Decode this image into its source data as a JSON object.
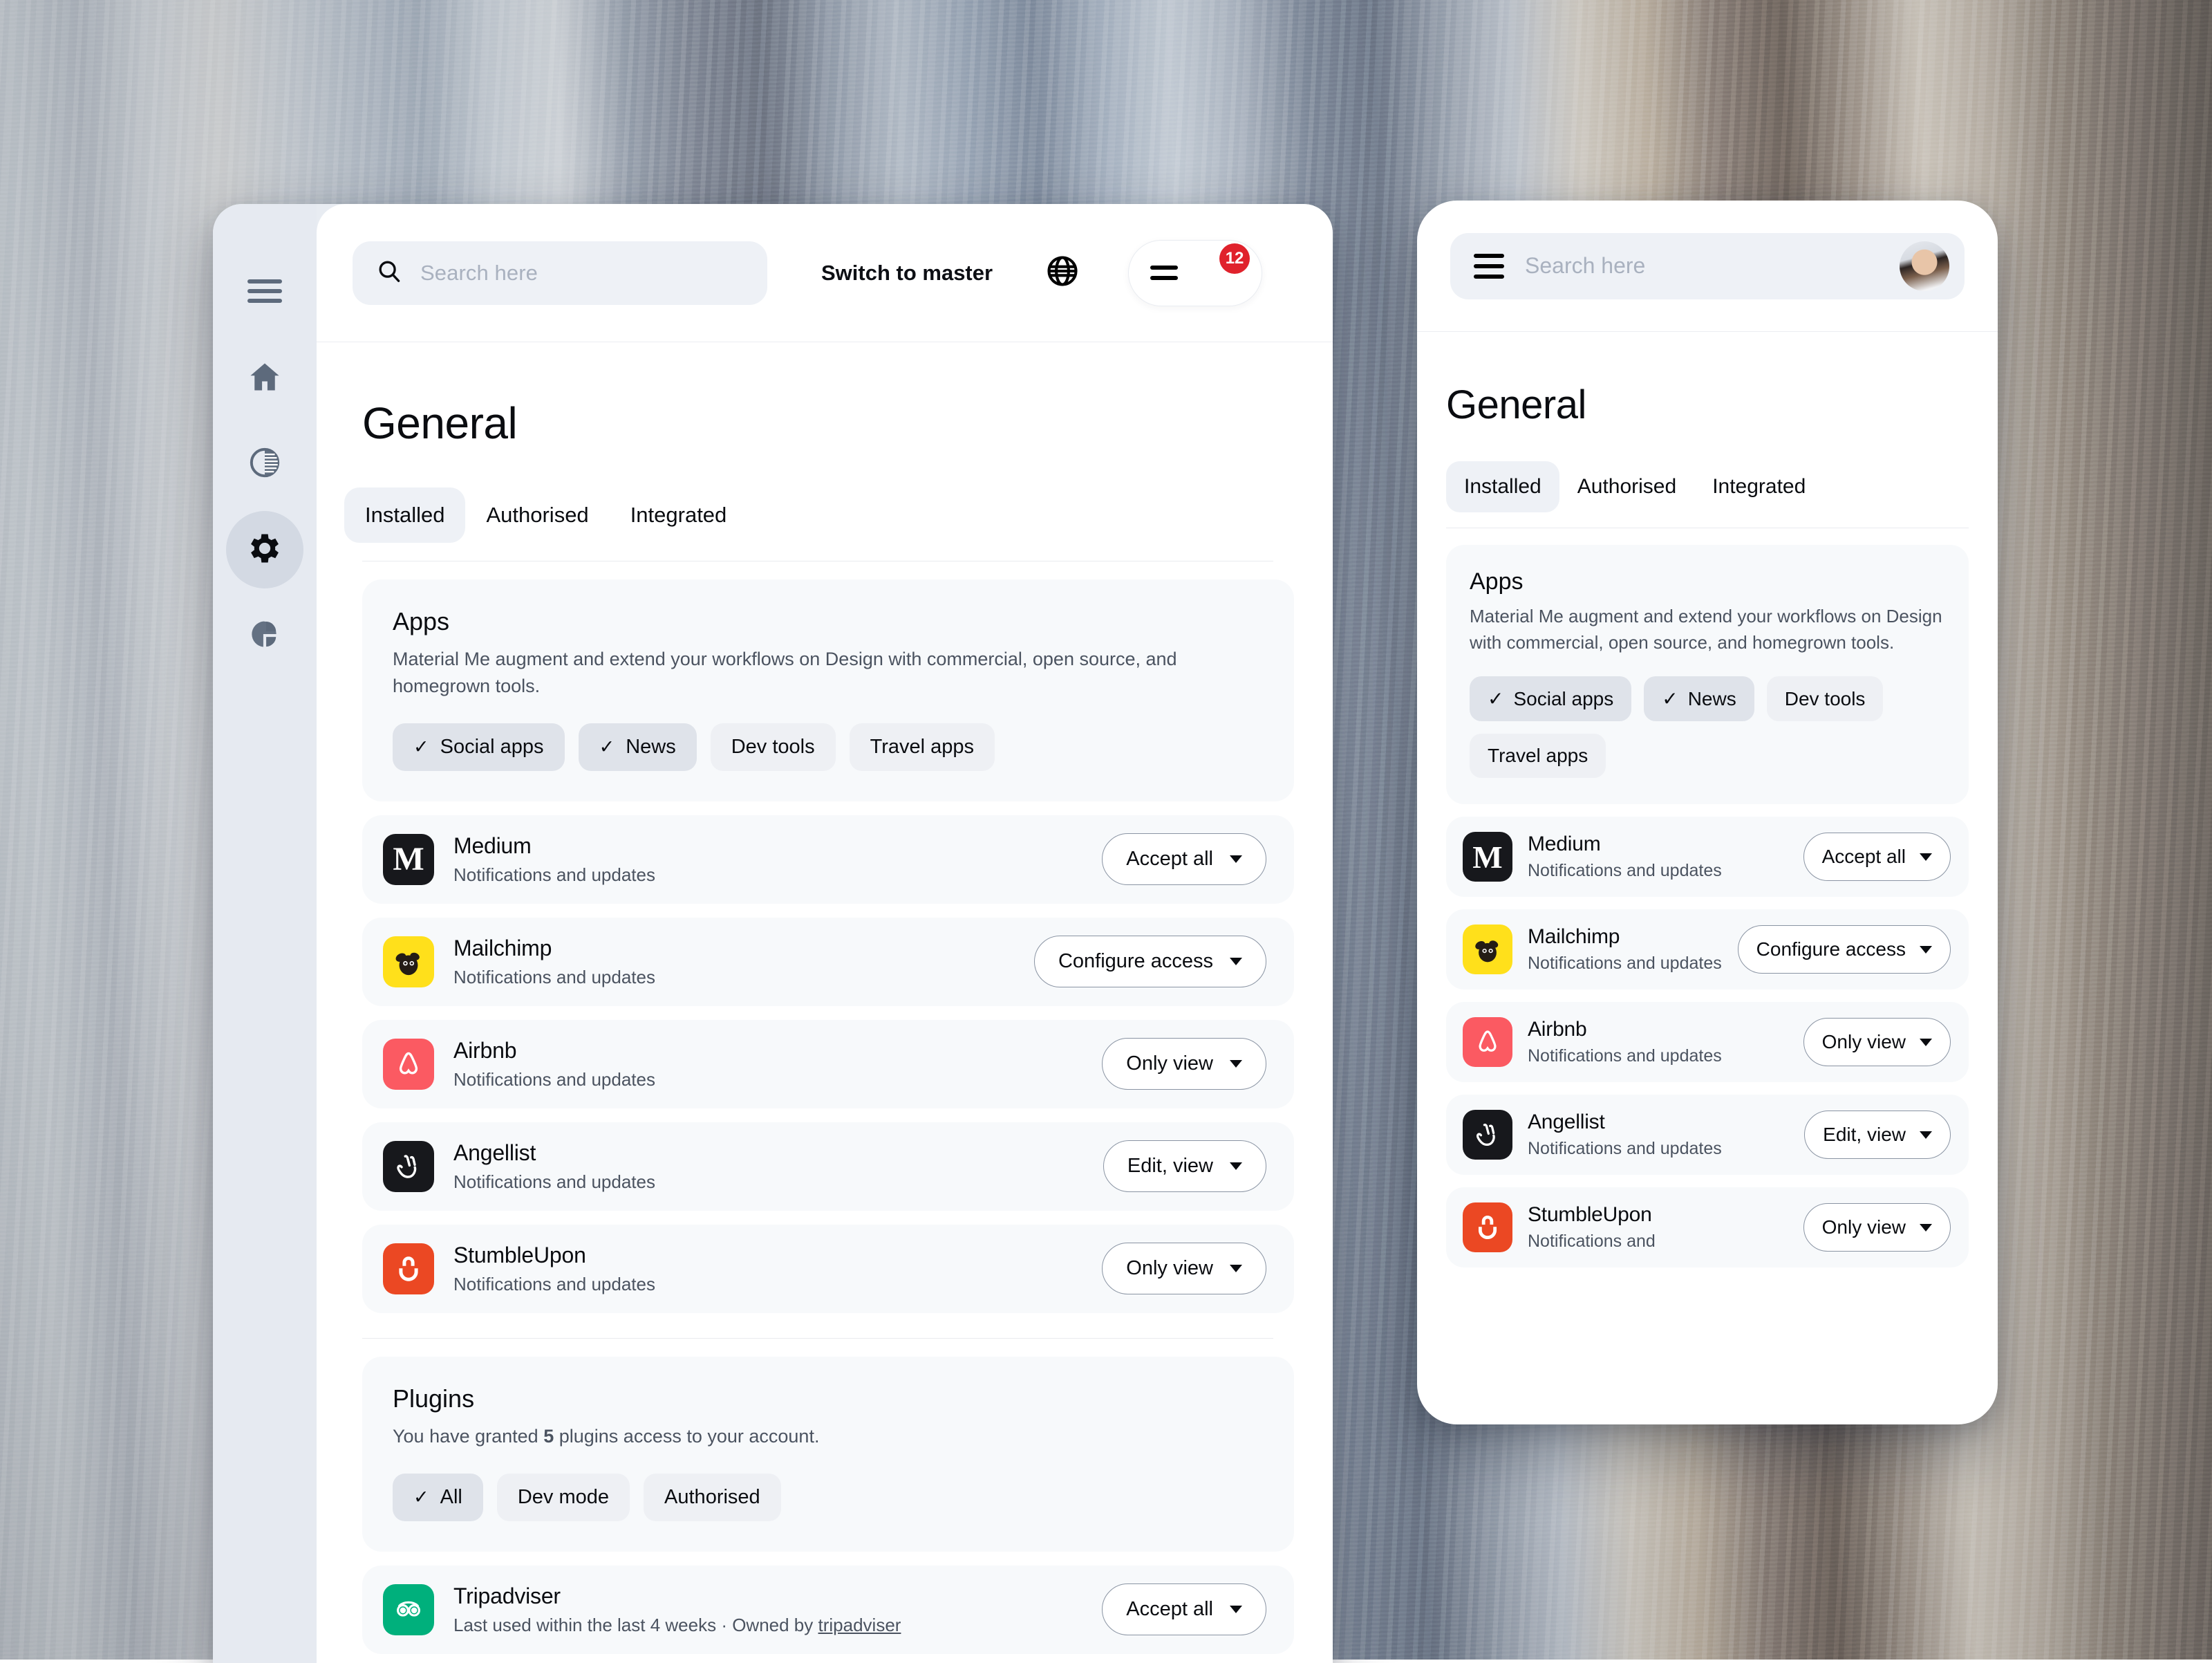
{
  "desktop": {
    "rail": {
      "items": [
        {
          "name": "menu-icon",
          "icon": "hamburger"
        },
        {
          "name": "home-icon",
          "icon": "home"
        },
        {
          "name": "contrast-icon",
          "icon": "contrast"
        },
        {
          "name": "settings-icon",
          "icon": "gear",
          "active": true
        },
        {
          "name": "analytics-icon",
          "icon": "pie"
        }
      ]
    },
    "topbar": {
      "search_placeholder": "Search here",
      "search_value": "",
      "switch_label": "Switch to master",
      "language_icon": "globe-icon",
      "notification_count": "12"
    },
    "page_title": "General",
    "tabs": [
      {
        "label": "Installed",
        "active": true
      },
      {
        "label": "Authorised",
        "active": false
      },
      {
        "label": "Integrated",
        "active": false
      }
    ],
    "apps_card": {
      "title": "Apps",
      "description": "Material Me augment and extend your workflows on Design with commercial, open source, and homegrown tools.",
      "chips": [
        {
          "label": "Social apps",
          "selected": true
        },
        {
          "label": "News",
          "selected": true
        },
        {
          "label": "Dev tools",
          "selected": false
        },
        {
          "label": "Travel apps",
          "selected": false
        }
      ]
    },
    "apps": [
      {
        "name": "Medium",
        "subtitle": "Notifications and updates",
        "action": "Accept all",
        "icon": "medium-icon"
      },
      {
        "name": "Mailchimp",
        "subtitle": "Notifications and updates",
        "action": "Configure access",
        "icon": "mailchimp-icon"
      },
      {
        "name": "Airbnb",
        "subtitle": "Notifications and updates",
        "action": "Only view",
        "icon": "airbnb-icon"
      },
      {
        "name": "Angellist",
        "subtitle": "Notifications and updates",
        "action": "Edit, view",
        "icon": "angellist-icon"
      },
      {
        "name": "StumbleUpon",
        "subtitle": "Notifications and updates",
        "action": "Only view",
        "icon": "stumbleupon-icon"
      }
    ],
    "plugins_card": {
      "title": "Plugins",
      "description_before": "You have granted ",
      "count": "5",
      "description_after": " plugins access to your account.",
      "chips": [
        {
          "label": "All",
          "selected": true
        },
        {
          "label": "Dev mode",
          "selected": false
        },
        {
          "label": "Authorised",
          "selected": false
        }
      ]
    },
    "plugins": [
      {
        "name": "Tripadviser",
        "subtitle_before": "Last used within the last 4 weeks · Owned by ",
        "owner": "tripadviser",
        "action": "Accept all",
        "icon": "tripadvisor-icon"
      }
    ]
  },
  "mobile": {
    "topbar": {
      "menu_icon": "hamburger-icon",
      "search_placeholder": "Search here",
      "search_value": "",
      "avatar": "user-avatar"
    },
    "page_title": "General",
    "tabs": [
      {
        "label": "Installed",
        "active": true
      },
      {
        "label": "Authorised",
        "active": false
      },
      {
        "label": "Integrated",
        "active": false
      }
    ],
    "apps_card": {
      "title": "Apps",
      "description": "Material Me augment and extend your workflows on Design with commercial, open source, and homegrown tools.",
      "chips": [
        {
          "label": "Social apps",
          "selected": true
        },
        {
          "label": "News",
          "selected": true
        },
        {
          "label": "Dev tools",
          "selected": false
        },
        {
          "label": "Travel apps",
          "selected": false
        }
      ]
    },
    "apps": [
      {
        "name": "Medium",
        "subtitle": "Notifications and updates",
        "action": "Accept all",
        "icon": "medium-icon"
      },
      {
        "name": "Mailchimp",
        "subtitle": "Notifications and updates",
        "action": "Configure access",
        "icon": "mailchimp-icon"
      },
      {
        "name": "Airbnb",
        "subtitle": "Notifications and updates",
        "action": "Only view",
        "icon": "airbnb-icon"
      },
      {
        "name": "Angellist",
        "subtitle": "Notifications and updates",
        "action": "Edit, view",
        "icon": "angellist-icon"
      },
      {
        "name": "StumbleUpon",
        "subtitle": "Notifications and",
        "action": "Only view",
        "icon": "stumbleupon-icon"
      }
    ]
  },
  "colors": {
    "surface": "#f7f9fb",
    "chip": "#eef0f4",
    "chip_selected": "#dfe3ea",
    "rail": "#e6eaf1",
    "badge_red": "#e0222c",
    "medium": "#17181c",
    "mailchimp": "#ffe01b",
    "airbnb": "#fb5a62",
    "angellist": "#17181c",
    "stumbleupon": "#eb4823",
    "tripadvisor": "#00b07c",
    "text_primary": "#0a0c10",
    "text_secondary": "#4b5360",
    "placeholder": "#a9b1bf"
  }
}
